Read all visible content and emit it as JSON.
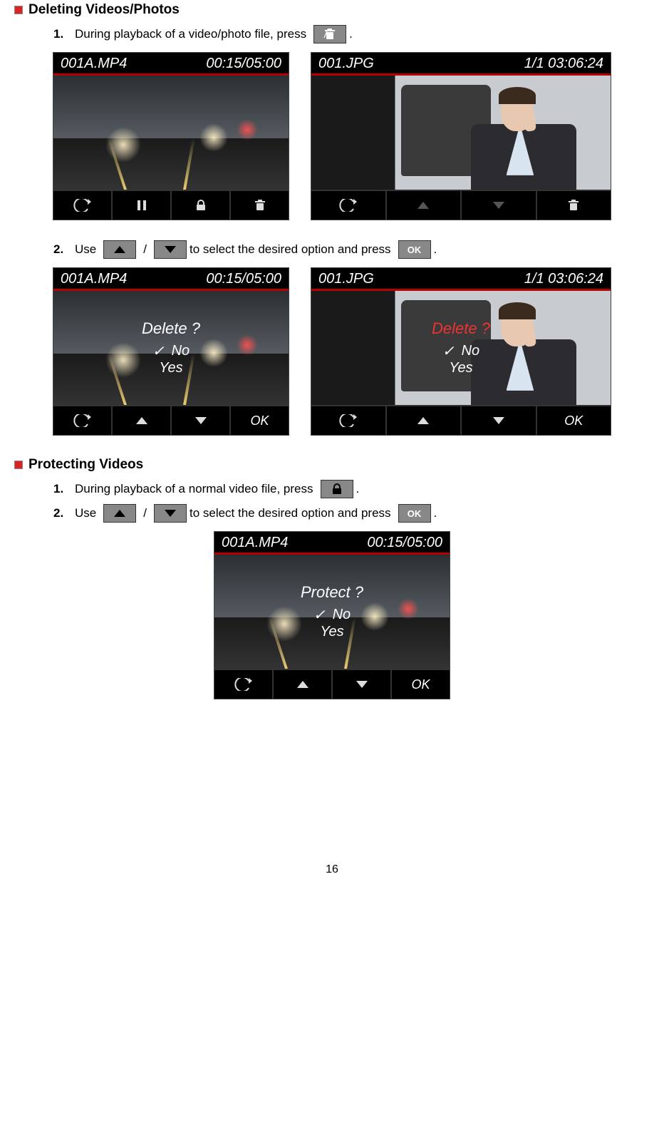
{
  "section1": {
    "title": "Deleting Videos/Photos",
    "step1_num": "1.",
    "step1_a": "During playback of a video/photo file, press ",
    "step1_b": ".",
    "step2_num": "2.",
    "step2_a": "Use ",
    "step2_b": " / ",
    "step2_c": " to select the desired option and press ",
    "step2_d": "."
  },
  "section2": {
    "title": "Protecting Videos",
    "step1_num": "1.",
    "step1_a": "During playback of a normal video file, press ",
    "step1_b": ".",
    "step2_num": "2.",
    "step2_a": "Use ",
    "step2_b": " / ",
    "step2_c": " to select the desired option and press ",
    "step2_d": "."
  },
  "screens": {
    "video_file": "001A.MP4",
    "video_time": "00:15/05:00",
    "photo_file": "001.JPG",
    "photo_time": "1/1 03:06:24",
    "delete_q": "Delete ?",
    "protect_q": "Protect ?",
    "opt_no": "No",
    "opt_yes": "Yes",
    "ok_label": "OK"
  },
  "buttons": {
    "ok": "OK"
  },
  "page_number": "16"
}
